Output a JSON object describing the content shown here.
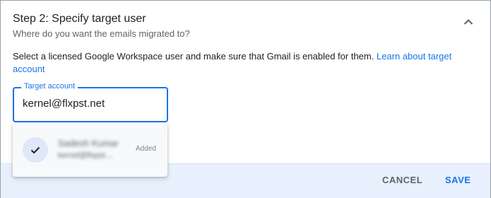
{
  "step": {
    "title": "Step 2: Specify target user",
    "subtitle": "Where do you want the emails migrated to?"
  },
  "description": {
    "text": "Select a licensed Google Workspace user and make sure that Gmail is enabled for them. ",
    "link": "Learn about target account"
  },
  "target_field": {
    "label": "Target account",
    "value": "kernel@flxpst.net"
  },
  "suggestion": {
    "name": "Sadesh Kumar",
    "email": "kernel@flxpst....",
    "status": "Added"
  },
  "footer": {
    "cancel": "CANCEL",
    "save": "SAVE"
  },
  "colors": {
    "accent": "#1a73e8",
    "footer_bg": "#e8f0fe"
  }
}
